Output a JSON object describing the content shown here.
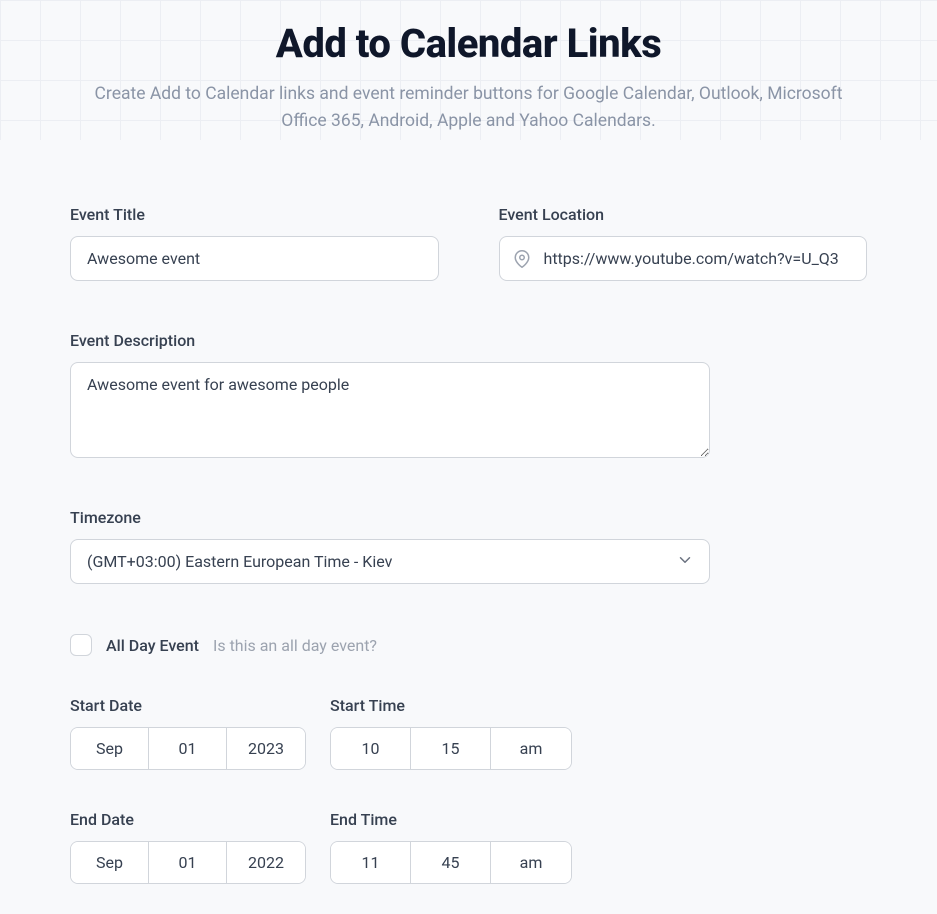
{
  "header": {
    "title": "Add to Calendar Links",
    "subtitle": "Create Add to Calendar links and event reminder buttons for Google Calendar, Outlook, Microsoft Office 365, Android, Apple and Yahoo Calendars."
  },
  "form": {
    "event_title": {
      "label": "Event Title",
      "value": "Awesome event"
    },
    "event_location": {
      "label": "Event Location",
      "value": "https://www.youtube.com/watch?v=U_Q3"
    },
    "event_description": {
      "label": "Event Description",
      "value": "Awesome event for awesome people"
    },
    "timezone": {
      "label": "Timezone",
      "value": "(GMT+03:00) Eastern European Time - Kiev"
    },
    "all_day": {
      "label": "All Day Event",
      "hint": "Is this an all day event?",
      "checked": false
    },
    "start_date": {
      "label": "Start Date",
      "month": "Sep",
      "day": "01",
      "year": "2023"
    },
    "start_time": {
      "label": "Start Time",
      "hour": "10",
      "minute": "15",
      "ampm": "am"
    },
    "end_date": {
      "label": "End Date",
      "month": "Sep",
      "day": "01",
      "year": "2022"
    },
    "end_time": {
      "label": "End Time",
      "hour": "11",
      "minute": "45",
      "ampm": "am"
    }
  }
}
